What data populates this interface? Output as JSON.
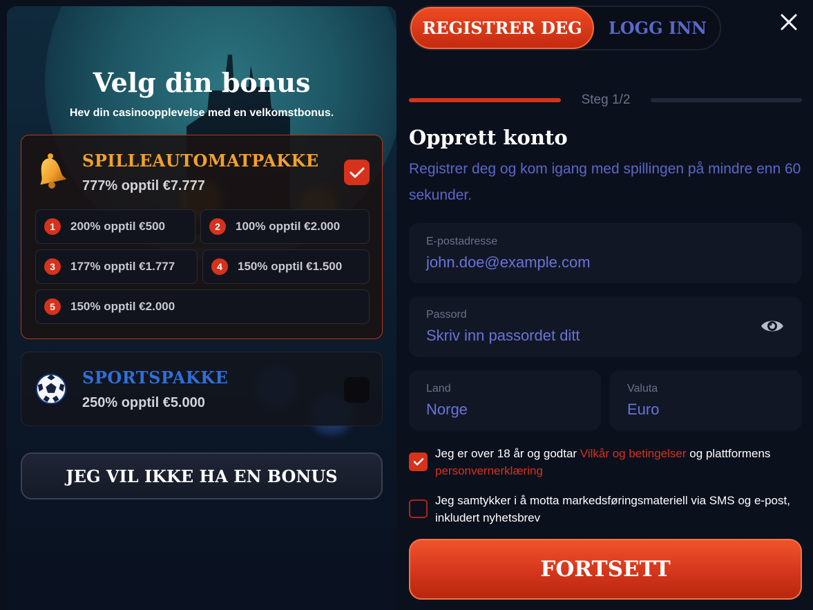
{
  "left": {
    "title": "Velg din bonus",
    "subtitle": "Hev din casinoopplevelse med en velkomstbonus."
  },
  "packages": [
    {
      "icon": "bell-icon",
      "title": "SPILLEAUTOMATPAKKE",
      "offer": "777% opptil €7.777",
      "selected": true,
      "options": [
        {
          "num": "1",
          "text": "200% opptil €500"
        },
        {
          "num": "2",
          "text": "100% opptil €2.000"
        },
        {
          "num": "3",
          "text": "177% opptil €1.777"
        },
        {
          "num": "4",
          "text": "150% opptil €1.500"
        },
        {
          "num": "5",
          "text": "150% opptil €2.000"
        }
      ]
    },
    {
      "icon": "soccer-ball-icon",
      "title": "SPORTSPAKKE",
      "offer": "250% opptil €5.000",
      "selected": false
    }
  ],
  "no_bonus_label": "JEG VIL IKKE HA EN BONUS",
  "tabs": {
    "register": "REGISTRER DEG",
    "login": "LOGG INN"
  },
  "step": "Steg 1/2",
  "form": {
    "title": "Opprett konto",
    "description": "Registrer deg og kom igang med spillingen på mindre enn 60 sekunder.",
    "email": {
      "label": "E-postadresse",
      "value": "john.doe@example.com"
    },
    "password": {
      "label": "Passord",
      "placeholder": "Skriv inn passordet ditt"
    },
    "country": {
      "label": "Land",
      "value": "Norge"
    },
    "currency": {
      "label": "Valuta",
      "value": "Euro"
    }
  },
  "consents": {
    "terms": {
      "checked": true,
      "text_before": "Jeg er over 18 år og godtar ",
      "link_terms": "Vilkår og betingelser",
      "text_middle": " og plattformens ",
      "link_privacy": "personvernerklæring"
    },
    "marketing": {
      "checked": false,
      "text": "Jeg samtykker i å motta markedsføringsmateriell via SMS og e-post, inkludert nyhetsbrev"
    }
  },
  "submit_label": "FORTSETT",
  "colors": {
    "accent_red": "#d6321c",
    "slot_title_gold": "#f2a12a",
    "sport_title_blue": "#2f6fd8",
    "field_text_blue": "#6874d8",
    "background": "#0b101d"
  }
}
